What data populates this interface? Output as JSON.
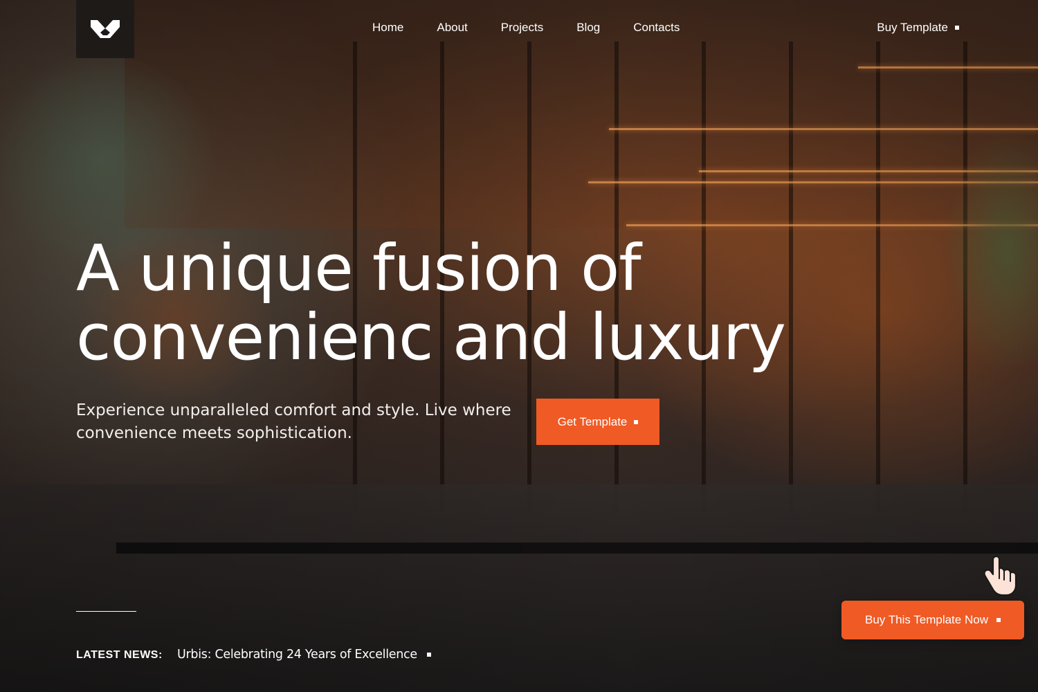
{
  "brand": {
    "logo_icon": "chevron-v-logo-icon",
    "logo_box_color": "#1e1a18"
  },
  "nav": {
    "items": [
      {
        "label": "Home"
      },
      {
        "label": "About"
      },
      {
        "label": "Projects"
      },
      {
        "label": "Blog"
      },
      {
        "label": "Contacts"
      }
    ],
    "cta_label": "Buy Template",
    "cta_icon": "square-bullet-icon"
  },
  "hero": {
    "title_line1": "A unique fusion of",
    "title_line2": "convenienc and luxury",
    "subtitle": "Experience unparalleled comfort and style. Live where convenience meets sophistication.",
    "button_label": "Get Template",
    "button_icon": "square-bullet-icon"
  },
  "news": {
    "label": "LATEST NEWS:",
    "headline": "Urbis: Celebrating 24 Years of Excellence",
    "icon": "square-bullet-icon"
  },
  "floating_cta": {
    "label": "Buy This Template Now",
    "icon": "square-bullet-icon",
    "pointer_icon": "pointing-hand-icon"
  },
  "colors": {
    "accent": "#f05a24",
    "text": "#ffffff"
  }
}
